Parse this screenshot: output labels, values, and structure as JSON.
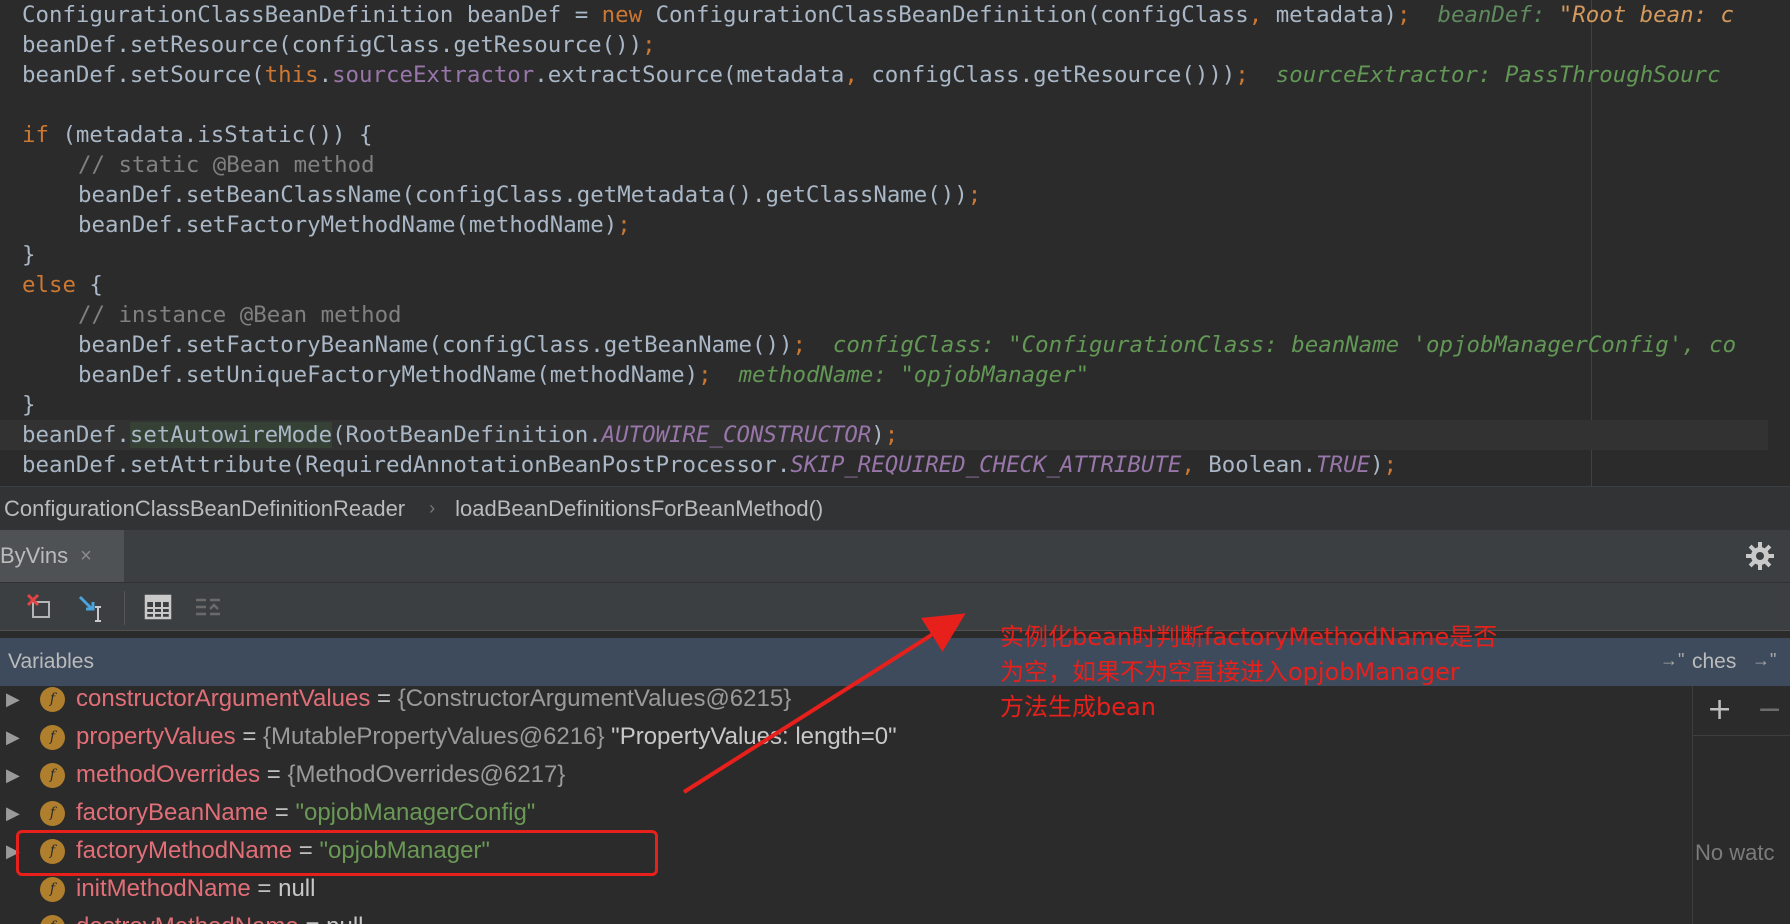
{
  "editor": {
    "lines": [
      {
        "parts": [
          {
            "t": "ConfigurationClassBeanDefinition beanDef = ",
            "c": ""
          },
          {
            "t": "new ",
            "c": "tok-kw"
          },
          {
            "t": "ConfigurationClassBeanDefinition(configClass",
            "c": ""
          },
          {
            "t": ", ",
            "c": "tok-kw"
          },
          {
            "t": "metadata)",
            "c": ""
          },
          {
            "t": ";  ",
            "c": "tok-kw"
          },
          {
            "t": "beanDef: ",
            "c": "tok-hint"
          },
          {
            "t": "\"Root bean: c",
            "c": "tok-hintstr"
          }
        ]
      },
      {
        "parts": [
          {
            "t": "beanDef.setResource(configClass.getResource())",
            "c": ""
          },
          {
            "t": ";",
            "c": "tok-kw"
          }
        ]
      },
      {
        "parts": [
          {
            "t": "beanDef.setSource(",
            "c": ""
          },
          {
            "t": "this",
            "c": "tok-kw"
          },
          {
            "t": ".",
            "c": ""
          },
          {
            "t": "sourceExtractor",
            "c": "tok-field"
          },
          {
            "t": ".extractSource(metadata",
            "c": ""
          },
          {
            "t": ", ",
            "c": "tok-kw"
          },
          {
            "t": "configClass.getResource()))",
            "c": ""
          },
          {
            "t": ";  ",
            "c": "tok-kw"
          },
          {
            "t": "sourceExtractor: PassThroughSourc",
            "c": "tok-hintgreen"
          }
        ]
      },
      {
        "parts": []
      },
      {
        "parts": [
          {
            "t": "if ",
            "c": "tok-kw"
          },
          {
            "t": "(metadata.isStatic()) {",
            "c": ""
          }
        ]
      },
      {
        "indent": true,
        "parts": [
          {
            "t": "// static @Bean method",
            "c": "tok-cmt"
          }
        ]
      },
      {
        "indent": true,
        "parts": [
          {
            "t": "beanDef.setBeanClassName(configClass.getMetadata().getClassName())",
            "c": ""
          },
          {
            "t": ";",
            "c": "tok-kw"
          }
        ]
      },
      {
        "indent": true,
        "parts": [
          {
            "t": "beanDef.setFactoryMethodName(methodName)",
            "c": ""
          },
          {
            "t": ";",
            "c": "tok-kw"
          }
        ]
      },
      {
        "parts": [
          {
            "t": "}",
            "c": ""
          }
        ]
      },
      {
        "parts": [
          {
            "t": "else ",
            "c": "tok-kw"
          },
          {
            "t": "{",
            "c": ""
          }
        ]
      },
      {
        "indent": true,
        "parts": [
          {
            "t": "// instance @Bean method",
            "c": "tok-cmt"
          }
        ]
      },
      {
        "indent": true,
        "parts": [
          {
            "t": "beanDef.setFactoryBeanName(configClass.getBeanName())",
            "c": ""
          },
          {
            "t": ";  ",
            "c": "tok-kw"
          },
          {
            "t": "configClass: \"ConfigurationClass: beanName 'opjobManagerConfig', co",
            "c": "tok-hintgreen"
          }
        ]
      },
      {
        "indent": true,
        "parts": [
          {
            "t": "beanDef.setUniqueFactoryMethodName(methodName)",
            "c": ""
          },
          {
            "t": ";  ",
            "c": "tok-kw"
          },
          {
            "t": "methodName: \"opjobManager\"",
            "c": "tok-hintgreen"
          }
        ]
      },
      {
        "parts": [
          {
            "t": "}",
            "c": ""
          }
        ]
      },
      {
        "highlight": true,
        "parts": [
          {
            "t": "beanDef.",
            "c": ""
          },
          {
            "t": "setAutowireMode",
            "c": "tok-method-hl"
          },
          {
            "t": "(RootBeanDefinition.",
            "c": ""
          },
          {
            "t": "AUTOWIRE_CONSTRUCTOR",
            "c": "tok-static"
          },
          {
            "t": ")",
            "c": ""
          },
          {
            "t": ";",
            "c": "tok-kw"
          }
        ]
      },
      {
        "parts": [
          {
            "t": "beanDef.setAttribute(RequiredAnnotationBeanPostProcessor.",
            "c": ""
          },
          {
            "t": "SKIP_REQUIRED_CHECK_ATTRIBUTE",
            "c": "tok-static"
          },
          {
            "t": ", ",
            "c": "tok-kw"
          },
          {
            "t": "Boolean.",
            "c": ""
          },
          {
            "t": "TRUE",
            "c": "tok-static"
          },
          {
            "t": ")",
            "c": ""
          },
          {
            "t": ";",
            "c": "tok-kw"
          }
        ]
      }
    ]
  },
  "breadcrumb": {
    "class_name": "ConfigurationClassBeanDefinitionReader",
    "separator": "›",
    "method_name": "loadBeanDefinitionsForBeanMethod()"
  },
  "debug": {
    "tab_label": "ByVins",
    "tab_close": "×",
    "toolbar": [
      "restore-layout-icon",
      "step-into-icon",
      "evaluate-table-icon",
      "disabled-list-icon"
    ],
    "variables_label": "Variables",
    "pin_glyph": "→\"",
    "watches_label": "ches",
    "watches_add": "+",
    "watches_remove": "−",
    "watches_empty": "No watc",
    "variables": [
      {
        "arrow": "▶",
        "name": "constructorArgumentValues",
        "eq": " = ",
        "ref": "{ConstructorArgumentValues@6215}",
        "str": "",
        "plain": ""
      },
      {
        "arrow": "▶",
        "name": "propertyValues",
        "eq": " = ",
        "ref": "{MutablePropertyValues@6216}",
        "str": "",
        "plain": " \"PropertyValues: length=0\""
      },
      {
        "arrow": "▶",
        "name": "methodOverrides",
        "eq": " = ",
        "ref": "{MethodOverrides@6217}",
        "str": "",
        "plain": ""
      },
      {
        "arrow": "▶",
        "name": "factoryBeanName",
        "eq": " = ",
        "ref": "",
        "str": "\"opjobManagerConfig\"",
        "plain": ""
      },
      {
        "arrow": "▶",
        "name": "factoryMethodName",
        "eq": " = ",
        "ref": "",
        "str": "\"opjobManager\"",
        "plain": ""
      },
      {
        "arrow": "",
        "name": "initMethodName",
        "eq": " = ",
        "ref": "",
        "str": "",
        "plain": "null"
      },
      {
        "arrow": "",
        "name": "destroyMethodName",
        "eq": " = ",
        "ref": "",
        "str": "",
        "plain": "null"
      }
    ],
    "badge_letter": "f"
  },
  "annotation": {
    "text": "实例化bean时判断factoryMethodName是否\n为空，如果不为空直接进入opjobManager\n方法生成bean",
    "color": "#e8201c"
  }
}
